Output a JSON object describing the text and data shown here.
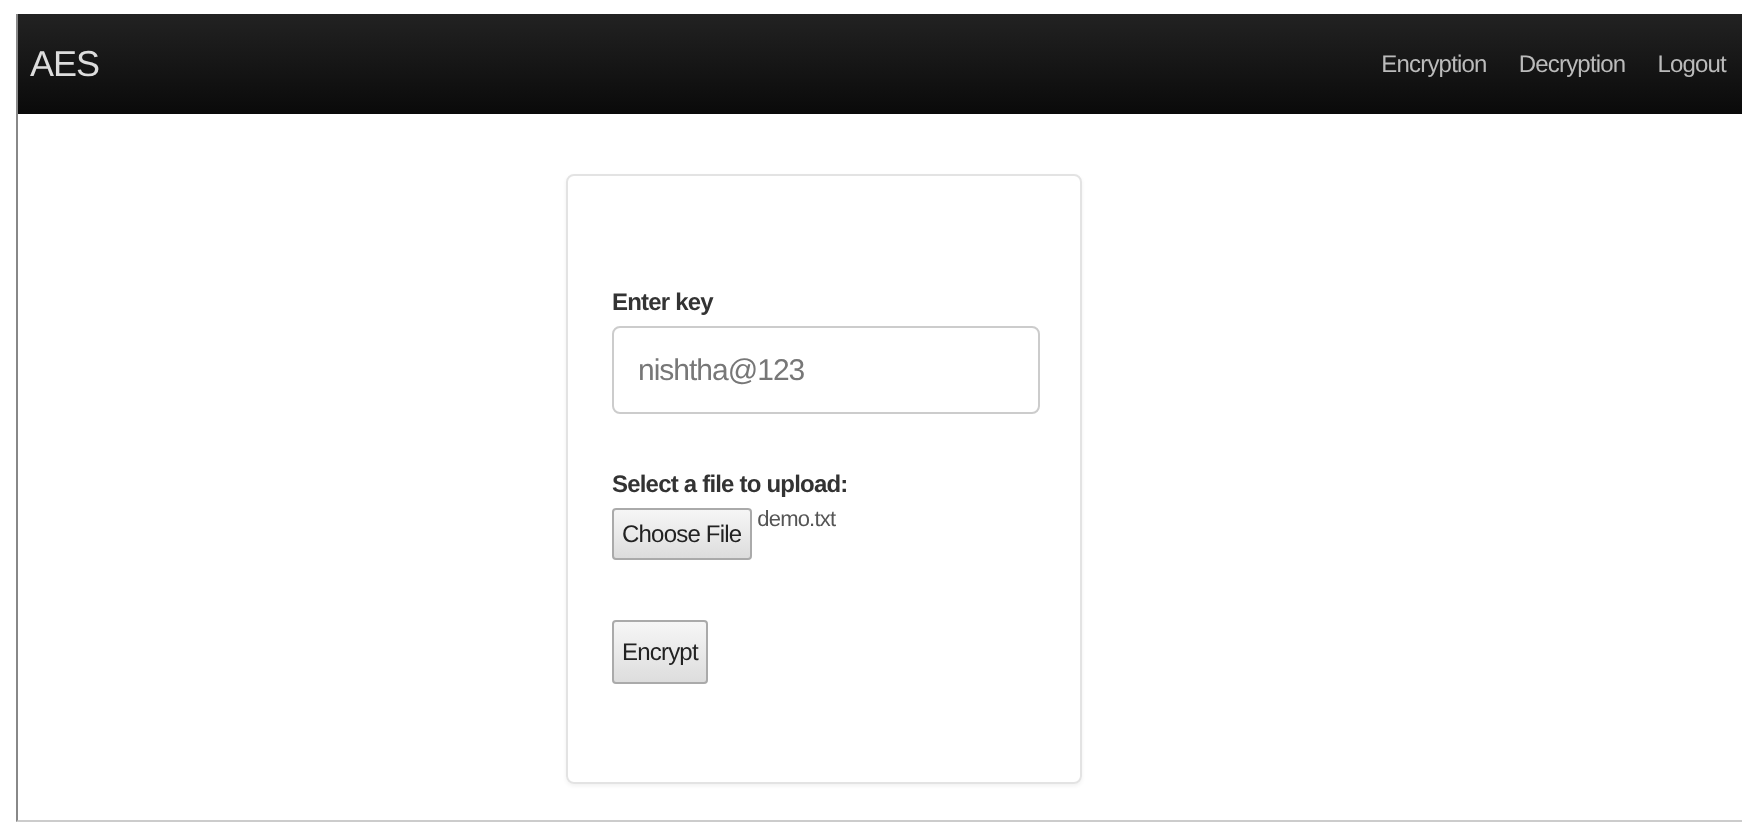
{
  "navbar": {
    "brand": "AES",
    "links": [
      "Encryption",
      "Decryption",
      "Logout"
    ]
  },
  "form": {
    "key_label": "Enter key",
    "key_value": "nishtha@123",
    "file_label": "Select a file to upload:",
    "file_button": "Choose File",
    "file_name": "demo.txt",
    "submit": "Encrypt"
  }
}
